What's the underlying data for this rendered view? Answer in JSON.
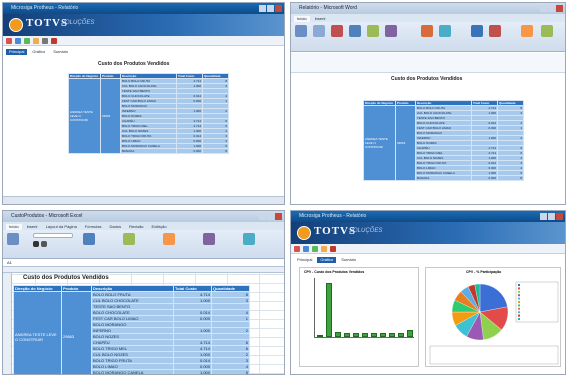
{
  "windows": {
    "tl": {
      "title": "Microsiga Protheus - Relatório",
      "brand": "TOTVS",
      "brand_sub": "SOLUÇÕES"
    },
    "tr": {
      "title": "Relatório - Microsoft Word"
    },
    "bl": {
      "title": "CustoProdutos - Microsoft Excel"
    },
    "br": {
      "title": "Microsiga Protheus - Relatório",
      "brand": "TOTVS",
      "brand_sub": "SOLUÇÕES"
    }
  },
  "report": {
    "title": "Custo dos Produtos Vendidos",
    "headers": [
      "Direção do Negócio",
      "Produto",
      "Descrição",
      "Total Custo",
      "Quantidade"
    ],
    "group_label": "ANDREA TESTE LEVE O CONSTRUIR",
    "code": "29663",
    "rows": [
      {
        "desc": "BOLO BOLO FRUTA",
        "cost": "4.714",
        "qty": "8"
      },
      {
        "desc": "CUL BOLO CHOCOLATE",
        "cost": "1.000",
        "qty": "3"
      },
      {
        "desc": "TESTE SAO BENTO",
        "cost": "",
        "qty": ""
      },
      {
        "desc": "BOLO CHOCOLATE",
        "cost": "0.014",
        "qty": "4"
      },
      {
        "desc": "FEST CAR BOLO LIMAO",
        "cost": "0.000",
        "qty": "1"
      },
      {
        "desc": "BOLO MORANGO",
        "cost": "",
        "qty": ""
      },
      {
        "desc": "INFERNO",
        "cost": "1.000",
        "qty": "2"
      },
      {
        "desc": "BOLO NOZES",
        "cost": "",
        "qty": ""
      },
      {
        "desc": "CHAPÉU",
        "cost": "4.714",
        "qty": "6"
      },
      {
        "desc": "BOLO TRIGO MEL",
        "cost": "4.714",
        "qty": "6"
      },
      {
        "desc": "CUL BOLO NOZES",
        "cost": "1.000",
        "qty": "2"
      },
      {
        "desc": "BOLO TRIGO FRUTA",
        "cost": "0.014",
        "qty": "3"
      },
      {
        "desc": "BOLO LIMAO",
        "cost": "0.000",
        "qty": "4"
      },
      {
        "desc": "BOLO MORANGO CANELA",
        "cost": "1.000",
        "qty": "5"
      },
      {
        "desc": "BANANA",
        "cost": "0.000",
        "qty": "8"
      }
    ]
  },
  "excel": {
    "tabs": [
      "Início",
      "Inserir",
      "Layout da Página",
      "Fórmulas",
      "Dados",
      "Revisão",
      "Exibição"
    ],
    "cell_ref": "A1"
  },
  "word": {
    "tabs": [
      "Início",
      "Inserir"
    ]
  },
  "toolbar": {
    "tabs": [
      "Principal",
      "Gráfico",
      "Sumário"
    ]
  },
  "colors": {
    "accent": "#1f5fa8",
    "header": "#2f73bf",
    "cell": "#a6c9ec",
    "bars": "#3ea33e"
  },
  "chart_data": [
    {
      "type": "bar",
      "title": "CPV - Custo dos Produtos Vendidos",
      "values": [
        0.02,
        0.65,
        0.06,
        0.05,
        0.05,
        0.05,
        0.05,
        0.05,
        0.05,
        0.05,
        0.08
      ],
      "ylim": [
        0,
        0.7
      ]
    },
    {
      "type": "pie",
      "title": "CPV - % Participação",
      "values": [
        22,
        14,
        12,
        10,
        9,
        8,
        7,
        6,
        5,
        4,
        3
      ],
      "colors": [
        "#3b6fd6",
        "#e34b4b",
        "#8fd14f",
        "#9b59b6",
        "#3ec1d3",
        "#f39c12",
        "#2ecc71",
        "#e67e22",
        "#5dade2",
        "#c0392b",
        "#1abc9c"
      ]
    }
  ]
}
